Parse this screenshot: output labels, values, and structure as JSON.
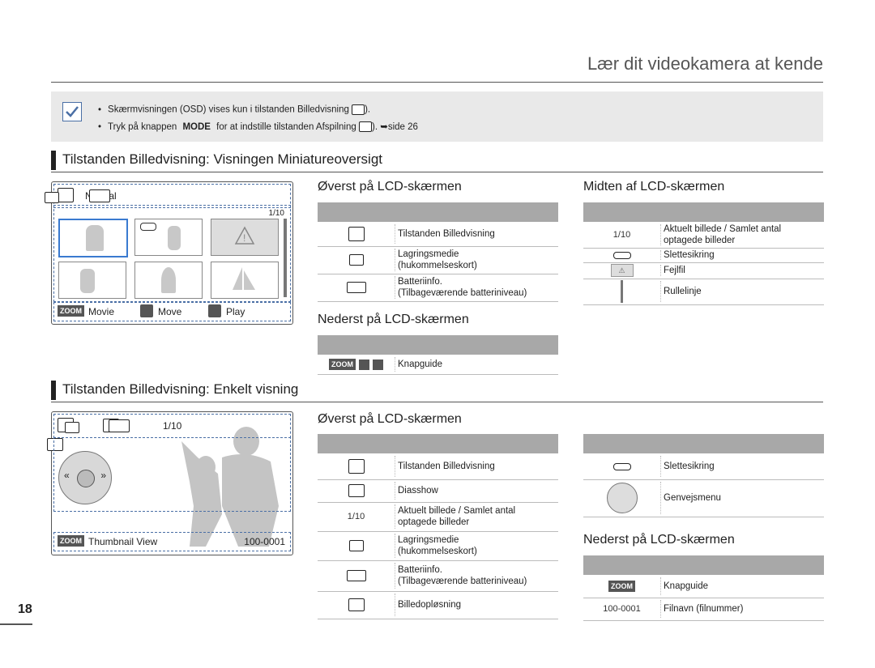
{
  "header": {
    "title": "Lær dit videokamera at kende"
  },
  "note": {
    "line1": "Skærmvisningen (OSD) vises kun i tilstanden Billedvisning",
    "line1_end": ").",
    "line2_pre": "Tryk på knappen",
    "line2_mode": "MODE",
    "line2_post": "for at indstille tilstanden Afspilning",
    "line2_end": "). ➥side 26"
  },
  "section1": {
    "title": "Tilstanden Billedvisning: Visningen Miniatureoversigt",
    "lcd": {
      "mode_label": "Normal",
      "counter": "1/10",
      "btn_movie": "Movie",
      "btn_move": "Move",
      "btn_play": "Play",
      "zoom": "ZOOM"
    },
    "top": {
      "heading": "Øverst på LCD-skærmen",
      "rows": [
        {
          "icon": "photo-view-icon",
          "desc": "Tilstanden Billedvisning"
        },
        {
          "icon": "memory-card-icon",
          "desc": "Lagringsmedie\n(hukommelseskort)"
        },
        {
          "icon": "battery-icon",
          "desc": "Batteriinfo.\n(Tilbageværende batteriniveau)"
        }
      ]
    },
    "middle": {
      "heading": "Midten af LCD-skærmen",
      "rows": [
        {
          "icon_text": "1/10",
          "desc": "Aktuelt billede / Samlet antal\noptagede billeder"
        },
        {
          "icon": "protect-key-icon",
          "desc": "Slettesikring"
        },
        {
          "icon": "error-warning-icon",
          "desc": "Fejlfil"
        },
        {
          "icon": "scroll-bar-icon",
          "desc": "Rullelinje"
        }
      ]
    },
    "bottom": {
      "heading": "Nederst på LCD-skærmen",
      "rows": [
        {
          "icon_text": "ZOOM",
          "desc": "Knapguide"
        }
      ]
    }
  },
  "section2": {
    "title": "Tilstanden Billedvisning: Enkelt visning",
    "lcd": {
      "counter": "1/10",
      "btn_thumb": "Thumbnail View",
      "file_no": "100-0001",
      "zoom": "ZOOM"
    },
    "top": {
      "heading": "Øverst på LCD-skærmen",
      "rows": [
        {
          "icon": "photo-view-icon",
          "desc": "Tilstanden Billedvisning"
        },
        {
          "icon": "slideshow-icon",
          "desc": "Diasshow"
        },
        {
          "icon_text": "1/10",
          "desc": "Aktuelt billede / Samlet antal\noptagede billeder"
        },
        {
          "icon": "memory-card-icon",
          "desc": "Lagringsmedie\n(hukommelseskort)"
        },
        {
          "icon": "battery-icon",
          "desc": "Batteriinfo.\n(Tilbageværende batteriniveau)"
        },
        {
          "icon": "resolution-icon",
          "desc": "Billedopløsning"
        }
      ]
    },
    "right": {
      "rows": [
        {
          "icon": "protect-key-icon",
          "desc": "Slettesikring"
        },
        {
          "icon": "shortcut-menu-icon",
          "desc": "Genvejsmenu"
        }
      ]
    },
    "bottom": {
      "heading": "Nederst på LCD-skærmen",
      "rows": [
        {
          "icon_text": "ZOOM",
          "desc": "Knapguide"
        },
        {
          "icon_text": "100-0001",
          "desc": "Filnavn (filnummer)"
        }
      ]
    }
  },
  "page_number": "18"
}
